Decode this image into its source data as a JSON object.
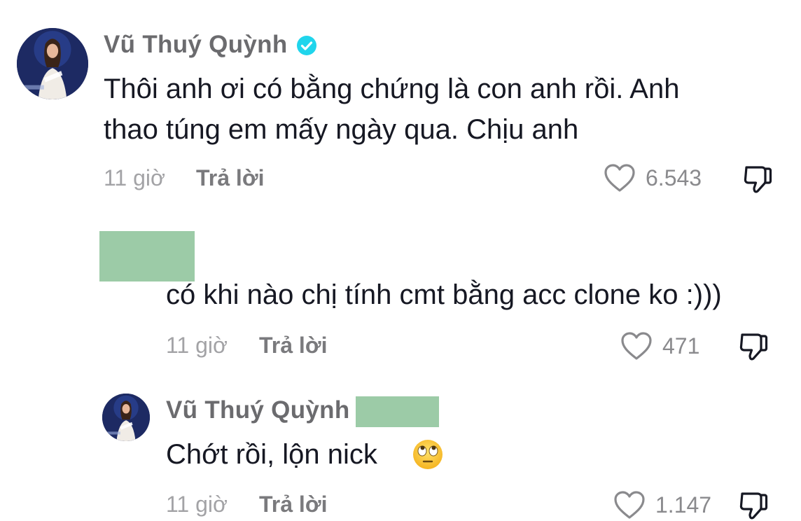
{
  "comments": [
    {
      "username": "Vũ Thuý Quỳnh",
      "verified": true,
      "text_line1": "Thôi anh ơi có bằng chứng là con anh rồi. Anh",
      "text_line2": "thao túng em mấy ngày qua. Chịu anh",
      "time": "11 giờ",
      "reply_label": "Trả lời",
      "likes": "6.543"
    }
  ],
  "replies": [
    {
      "username": "",
      "username_redacted": true,
      "text": "có khi nào chị tính cmt bằng acc clone ko :)))",
      "time": "11 giờ",
      "reply_label": "Trả lời",
      "likes": "471"
    },
    {
      "username": "Vũ Thuý Quỳnh",
      "mention_redacted": true,
      "text": "Chớt rồi, lộn nick",
      "emoji": "face-with-rolling-eyes",
      "time": "11 giờ",
      "reply_label": "Trả lời",
      "likes": "1.147"
    }
  ],
  "colors": {
    "verified_badge": "#20d5ec",
    "censor_block": "#9ccba7",
    "text": "#161823",
    "meta": "#a3a3a6"
  }
}
